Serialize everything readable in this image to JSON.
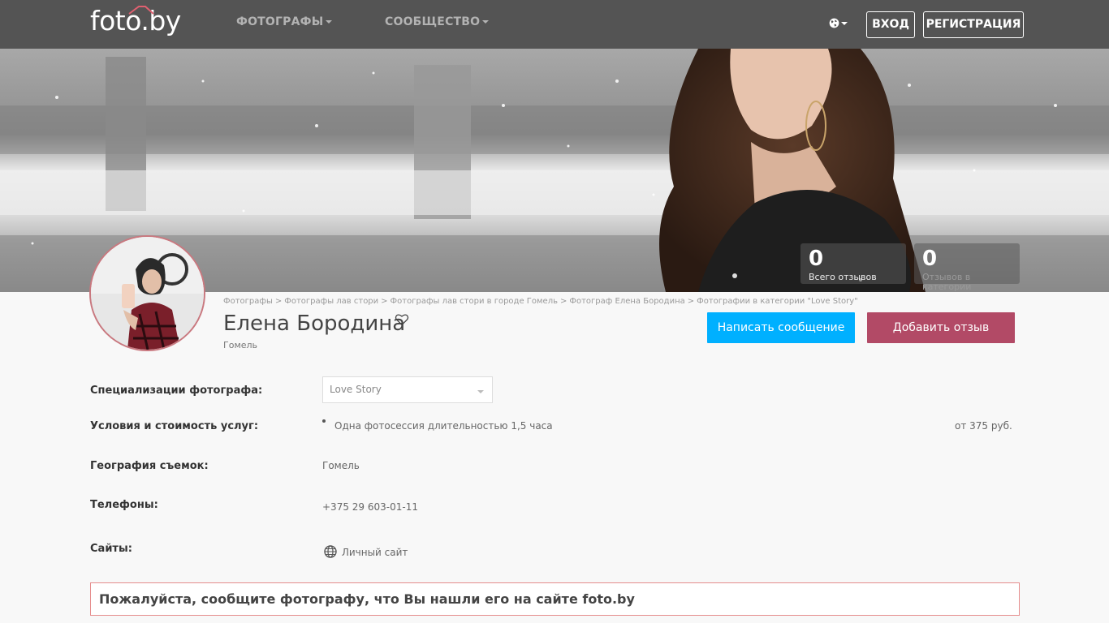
{
  "header": {
    "logo": "foto.by",
    "nav": [
      {
        "label": "ФОТОГРАФЫ"
      },
      {
        "label": "СООБЩЕСТВО"
      }
    ],
    "login_label": "ВХОД",
    "register_label": "РЕГИСТРАЦИЯ"
  },
  "stats": [
    {
      "value": "0",
      "label": "Всего отзывов"
    },
    {
      "value": "0",
      "label": "Отзывов в категории"
    }
  ],
  "breadcrumb": [
    "Фотографы",
    "Фотографы лав стори",
    "Фотографы лав стори в городе Гомель",
    "Фотограф Елена Бородина",
    "Фотографии в категории \"Love Story\""
  ],
  "breadcrumb_separator": ">",
  "profile": {
    "name": "Елена Бородина",
    "city": "Гомель",
    "message_button": "Написать сообщение",
    "review_button": "Добавить отзыв"
  },
  "details": {
    "specializations_label": "Специализации фотографа:",
    "specialization_selected": "Love Story",
    "conditions_label": "Условия и стоимость услуг:",
    "service": "Одна фотосессия длительностью 1,5 часа",
    "price": "от 375 руб.",
    "geography_label": "География съемок:",
    "geography_value": "Гомель",
    "phones_label": "Телефоны:",
    "phone": "+375 29 603-01-11",
    "sites_label": "Сайты:",
    "site": "Личный сайт"
  },
  "notice": "Пожалуйста, сообщите фотографу, что Вы нашли его на сайте foto.by",
  "colors": {
    "topbar": "#545454",
    "message_button": "#00b0ff",
    "review_button": "#b24a66",
    "notice_border": "#e58c8c"
  }
}
